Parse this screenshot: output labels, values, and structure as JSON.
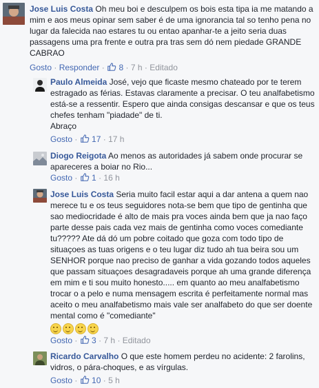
{
  "comments": [
    {
      "author": "Jose Luis Costa",
      "text": "Oh meu boi e desculpem os bois esta tipa ia me matando a mim e aos meus opinar sem saber é de uma ignorancia tal so tenho pena no lugar da falecida nao estares tu ou entao apanhar-te a jeito seria duas passagens uma pra frente e outra pra tras sem dó nem piedade GRANDE CABRAO",
      "like_label": "Gosto",
      "reply_label": "Responder",
      "likes": "8",
      "time": "7 h",
      "edited": "Editado"
    },
    {
      "author": "Paulo Almeida",
      "text": "José, vejo que ficaste mesmo chateado por te terem estragado as férias. Estavas claramente a precisar. O teu analfabetismo está-se a ressentir. Espero que ainda consigas descansar e que os teus chefes tenham \"piadade\" de ti.",
      "text2": "Abraço",
      "like_label": "Gosto",
      "likes": "17",
      "time": "17 h"
    },
    {
      "author": "Diogo Reigota",
      "text": "Ao menos as autoridades já sabem onde procurar se apareceres a boiar no Rio...",
      "like_label": "Gosto",
      "likes": "1",
      "time": "16 h"
    },
    {
      "author": "Jose Luis Costa",
      "text": "Seria muito facil estar aqui a dar antena a quem nao merece tu e os teus seguidores nota-se bem que tipo de gentinha que sao mediocridade é alto de mais pra voces ainda bem que ja nao faço parte desse pais cada vez mais de gentinha como voces comediante tu????? Ate dá dó um pobre coitado que goza com todo tipo de situaçoes as tuas origens e o teu lugar diz tudo ah tua beira sou um SENHOR porque nao preciso de ganhar a vida gozando todos aqueles que passam situaçoes desagradaveis porque ah uma grande diferença em mim e ti sou muito honesto..... em quanto ao meu analfabetismo trocar o a pelo e numa mensagem escrita é perfeitamente normal mas aceito o meu analfabetismo mais vale ser analfabeto do que ser doente mental como é \"comediante\"",
      "emoji": [
        "laughing-emoji",
        "laughing-emoji",
        "laughing-emoji",
        "laughing-emoji"
      ],
      "like_label": "Gosto",
      "likes": "3",
      "time": "7 h",
      "edited": "Editado"
    },
    {
      "author": "Ricardo Carvalho",
      "text": "O que este homem perdeu no acidente: 2 farolins, vidros, o pára-choques, e as vírgulas.",
      "like_label": "Gosto",
      "likes": "10",
      "time": "5 h"
    }
  ],
  "colors": {
    "link": "#365899",
    "action": "#4267b2",
    "meta": "#90949c",
    "background": "#f6f7f9"
  }
}
